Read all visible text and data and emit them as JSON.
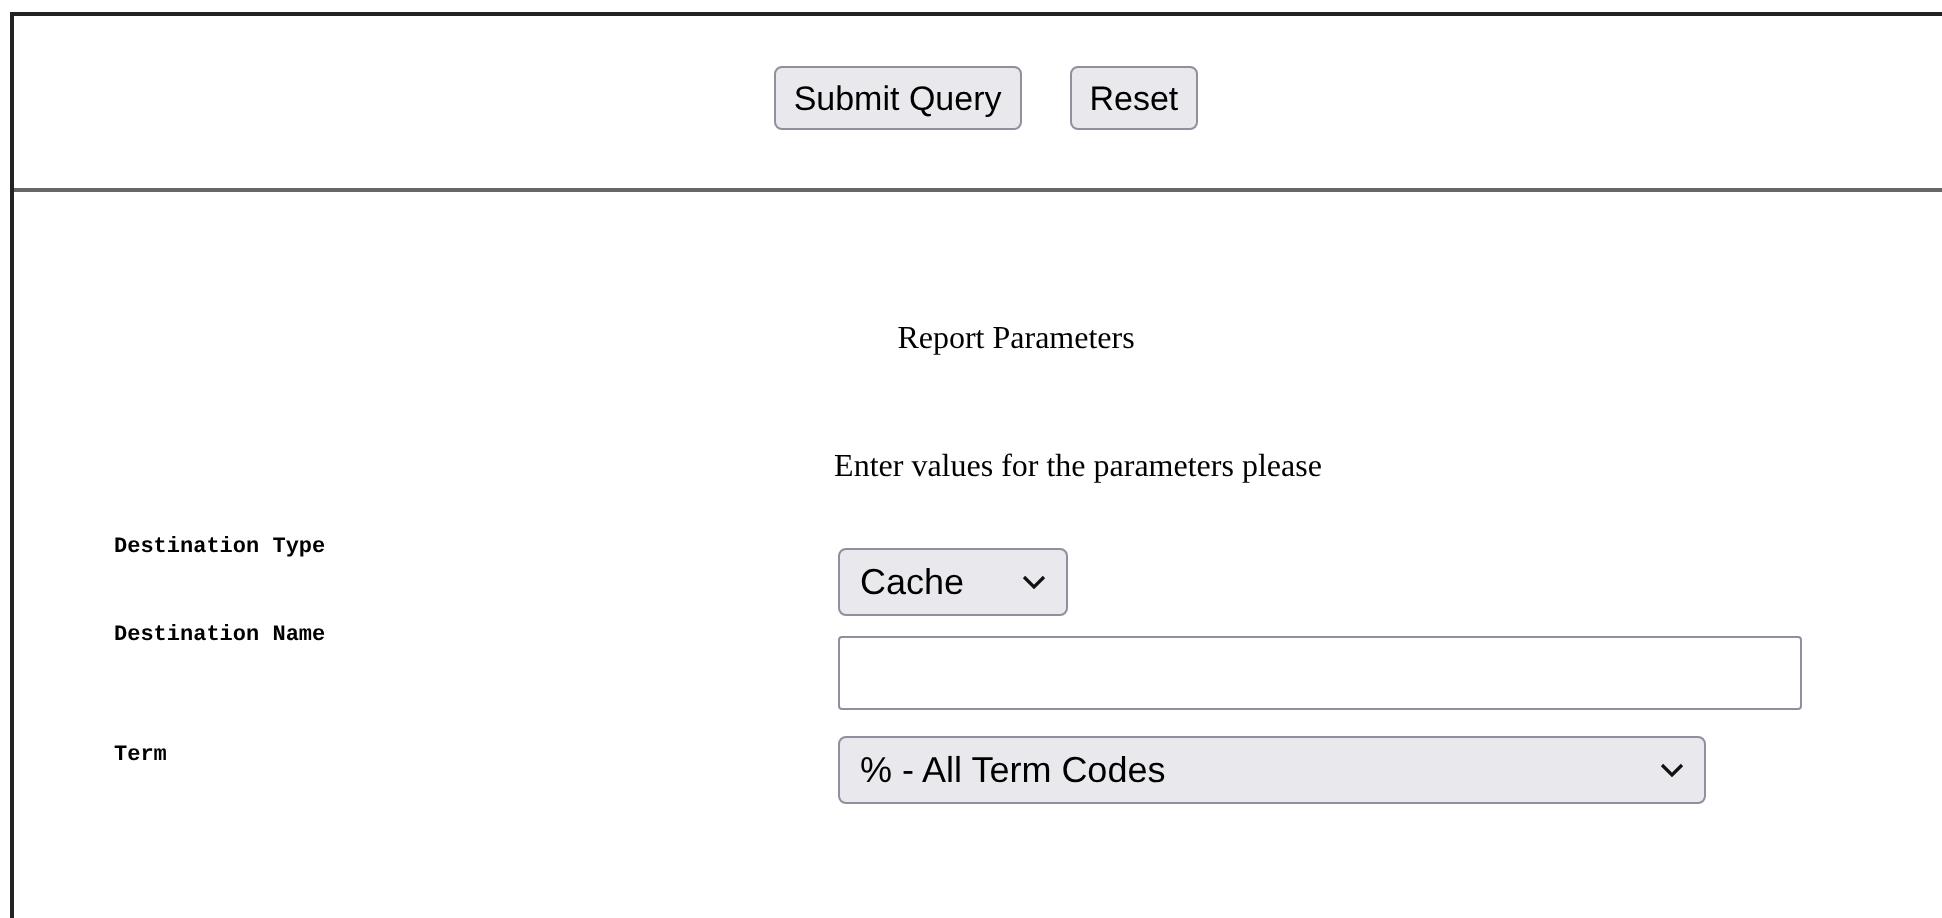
{
  "toolbar": {
    "buttons": [
      {
        "label": "Submit Query"
      },
      {
        "label": "Reset"
      }
    ]
  },
  "report": {
    "title": "Report Parameters",
    "instruction": "Enter values for the parameters please",
    "parameters": [
      {
        "label": "Destination Type",
        "kind": "select",
        "value": "Cache"
      },
      {
        "label": "Destination Name",
        "kind": "text"
      },
      {
        "label": "Term",
        "kind": "select",
        "value": "% - All Term Codes"
      }
    ]
  }
}
